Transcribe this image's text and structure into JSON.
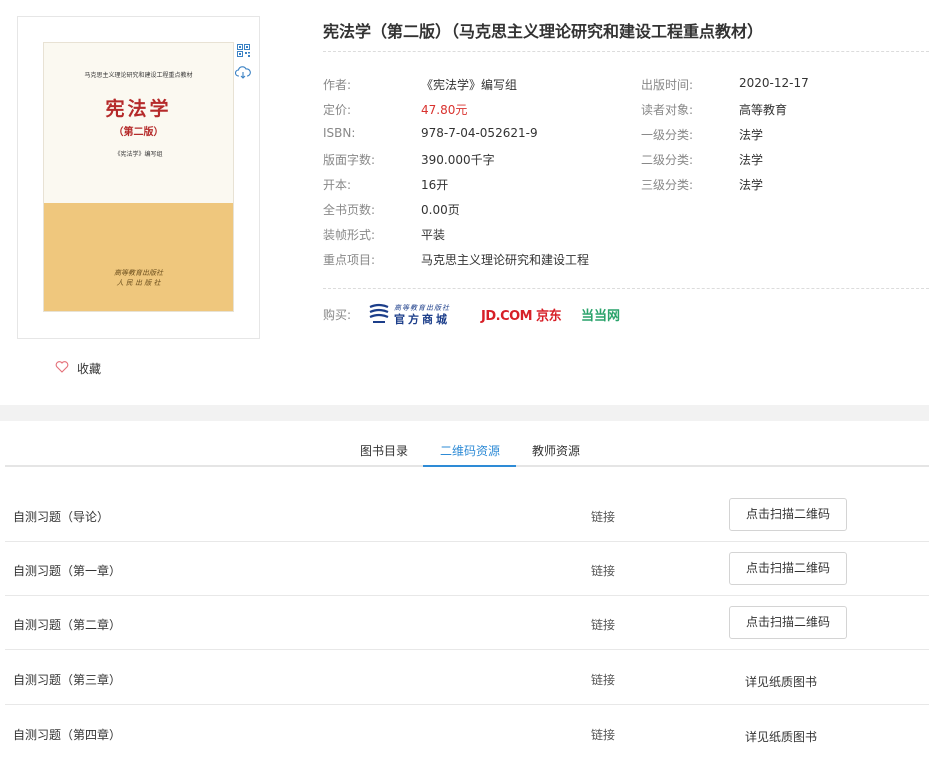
{
  "book": {
    "title": "宪法学（第二版）（马克思主义理论研究和建设工程重点教材）",
    "cover": {
      "series": "马克思主义理论研究和建设工程重点教材",
      "title": "宪法学",
      "edition": "（第二版）",
      "author": "《宪法学》编写组",
      "publisher_line1": "高等教育出版社",
      "publisher_line2": "人 民 出 版 社",
      "top_color": "#fbf9f1",
      "bottom_color": "#efc77d"
    },
    "favorite_label": "收藏"
  },
  "info_left": [
    {
      "label": "作者:",
      "value": "《宪法学》编写组"
    },
    {
      "label": "定价:",
      "value": "47.80元"
    },
    {
      "label": "ISBN:",
      "value": "978-7-04-052621-9"
    },
    {
      "label": "版面字数:",
      "value": "390.000千字"
    },
    {
      "label": "开本:",
      "value": "16开"
    },
    {
      "label": "全书页数:",
      "value": "0.00页"
    },
    {
      "label": "装帧形式:",
      "value": "平装"
    },
    {
      "label": "重点项目:",
      "value": "马克思主义理论研究和建设工程"
    }
  ],
  "info_right": [
    {
      "label": "出版时间:",
      "value": "2020-12-17"
    },
    {
      "label": "读者对象:",
      "value": "高等教育"
    },
    {
      "label": "一级分类:",
      "value": "法学"
    },
    {
      "label": "二级分类:",
      "value": "法学"
    },
    {
      "label": "三级分类:",
      "value": "法学"
    }
  ],
  "buy": {
    "label": "购买:",
    "hep_small": "高等教育出版社",
    "hep_big": "官方商城",
    "jd": "JD.COM 京东",
    "dangdang": "当当网"
  },
  "tabs": [
    {
      "label": "图书目录",
      "active": false
    },
    {
      "label": "二维码资源",
      "active": true
    },
    {
      "label": "教师资源",
      "active": false
    }
  ],
  "resources": [
    {
      "name": "自测习题（导论）",
      "type": "链接",
      "action": "点击扫描二维码",
      "kind": "button"
    },
    {
      "name": "自测习题（第一章）",
      "type": "链接",
      "action": "点击扫描二维码",
      "kind": "button"
    },
    {
      "name": "自测习题（第二章）",
      "type": "链接",
      "action": "点击扫描二维码",
      "kind": "button"
    },
    {
      "name": "自测习题（第三章）",
      "type": "链接",
      "action": "详见纸质图书",
      "kind": "text"
    },
    {
      "name": "自测习题（第四章）",
      "type": "链接",
      "action": "详见纸质图书",
      "kind": "text"
    }
  ],
  "colors": {
    "accent": "#2e8bd6",
    "price": "#d9322e",
    "jd": "#d71f27",
    "dangdang": "#2aa36b",
    "hep": "#1c3e8a"
  },
  "icons": {
    "qr": "qr-code-icon",
    "cloud": "cloud-download-icon",
    "heart": "heart-icon"
  }
}
